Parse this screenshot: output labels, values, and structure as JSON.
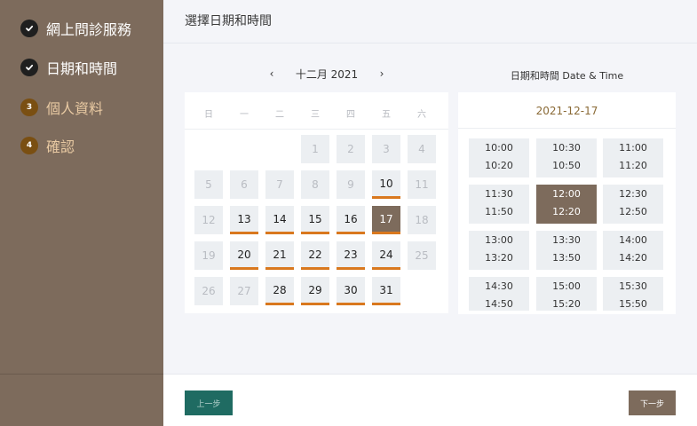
{
  "steps": [
    {
      "num": "",
      "label": "網上問診服務",
      "state": "done",
      "icon": "check-icon"
    },
    {
      "num": "",
      "label": "日期和時間",
      "state": "done",
      "icon": "check-icon"
    },
    {
      "num": "3",
      "label": "個人資料",
      "state": "pending"
    },
    {
      "num": "4",
      "label": "確認",
      "state": "pending"
    }
  ],
  "header": {
    "title": "選擇日期和時間"
  },
  "calendar": {
    "prev_icon": "‹",
    "next_icon": "›",
    "month_label": "十二月 2021",
    "weekdays": [
      "日",
      "一",
      "二",
      "三",
      "四",
      "五",
      "六"
    ],
    "weeks": [
      [
        null,
        null,
        null,
        {
          "d": "1",
          "s": "disabled"
        },
        {
          "d": "2",
          "s": "disabled"
        },
        {
          "d": "3",
          "s": "disabled"
        },
        {
          "d": "4",
          "s": "disabled"
        }
      ],
      [
        {
          "d": "5",
          "s": "disabled"
        },
        {
          "d": "6",
          "s": "disabled"
        },
        {
          "d": "7",
          "s": "disabled"
        },
        {
          "d": "8",
          "s": "disabled"
        },
        {
          "d": "9",
          "s": "disabled"
        },
        {
          "d": "10",
          "s": "avail"
        },
        {
          "d": "11",
          "s": "disabled"
        }
      ],
      [
        {
          "d": "12",
          "s": "disabled"
        },
        {
          "d": "13",
          "s": "avail"
        },
        {
          "d": "14",
          "s": "avail"
        },
        {
          "d": "15",
          "s": "avail"
        },
        {
          "d": "16",
          "s": "avail"
        },
        {
          "d": "17",
          "s": "selected"
        },
        {
          "d": "18",
          "s": "disabled"
        }
      ],
      [
        {
          "d": "19",
          "s": "disabled"
        },
        {
          "d": "20",
          "s": "avail"
        },
        {
          "d": "21",
          "s": "avail"
        },
        {
          "d": "22",
          "s": "avail"
        },
        {
          "d": "23",
          "s": "avail"
        },
        {
          "d": "24",
          "s": "avail"
        },
        {
          "d": "25",
          "s": "disabled"
        }
      ],
      [
        {
          "d": "26",
          "s": "disabled"
        },
        {
          "d": "27",
          "s": "disabled"
        },
        {
          "d": "28",
          "s": "avail"
        },
        {
          "d": "29",
          "s": "avail"
        },
        {
          "d": "30",
          "s": "avail"
        },
        {
          "d": "31",
          "s": "avail"
        },
        null
      ]
    ]
  },
  "time_panel": {
    "title": "日期和時間 Date & Time",
    "selected_date": "2021-12-17",
    "slots": [
      {
        "start": "10:00",
        "end": "10:20",
        "selected": false
      },
      {
        "start": "10:30",
        "end": "10:50",
        "selected": false
      },
      {
        "start": "11:00",
        "end": "11:20",
        "selected": false
      },
      {
        "start": "11:30",
        "end": "11:50",
        "selected": false
      },
      {
        "start": "12:00",
        "end": "12:20",
        "selected": true
      },
      {
        "start": "12:30",
        "end": "12:50",
        "selected": false
      },
      {
        "start": "13:00",
        "end": "13:20",
        "selected": false
      },
      {
        "start": "13:30",
        "end": "13:50",
        "selected": false
      },
      {
        "start": "14:00",
        "end": "14:20",
        "selected": false
      },
      {
        "start": "14:30",
        "end": "14:50",
        "selected": false
      },
      {
        "start": "15:00",
        "end": "15:20",
        "selected": false
      },
      {
        "start": "15:30",
        "end": "15:50",
        "selected": false
      }
    ]
  },
  "footer": {
    "prev_label": "上一步",
    "next_label": "下一步"
  },
  "colors": {
    "sidebar": "#7d6b5c",
    "accent": "#d9781e",
    "selected": "#7d6b5c",
    "prev_button": "#1f6b62",
    "date_text": "#8a6a36"
  }
}
